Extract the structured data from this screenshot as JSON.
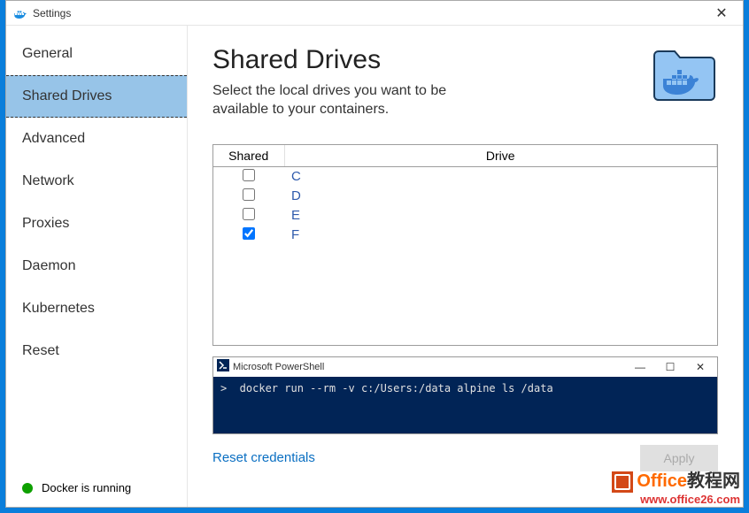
{
  "window": {
    "title": "Settings",
    "close_glyph": "✕"
  },
  "sidebar": {
    "items": [
      {
        "label": "General",
        "selected": false
      },
      {
        "label": "Shared Drives",
        "selected": true
      },
      {
        "label": "Advanced",
        "selected": false
      },
      {
        "label": "Network",
        "selected": false
      },
      {
        "label": "Proxies",
        "selected": false
      },
      {
        "label": "Daemon",
        "selected": false
      },
      {
        "label": "Kubernetes",
        "selected": false
      },
      {
        "label": "Reset",
        "selected": false
      }
    ],
    "status_text": "Docker is running"
  },
  "main": {
    "heading": "Shared Drives",
    "subtitle": "Select the local drives you want to be available to your containers.",
    "table": {
      "col_shared": "Shared",
      "col_drive": "Drive",
      "rows": [
        {
          "drive": "C",
          "shared": false
        },
        {
          "drive": "D",
          "shared": false
        },
        {
          "drive": "E",
          "shared": false
        },
        {
          "drive": "F",
          "shared": true
        }
      ]
    },
    "terminal": {
      "title": "Microsoft PowerShell",
      "minimize": "—",
      "maximize": "☐",
      "close": "✕",
      "command": ">  docker run --rm -v c:/Users:/data alpine ls /data"
    },
    "reset_credentials": "Reset credentials",
    "apply_label": "Apply"
  },
  "watermark": {
    "line1a": "Office",
    "line1b": "教程网",
    "line2": "www.office26.com"
  }
}
